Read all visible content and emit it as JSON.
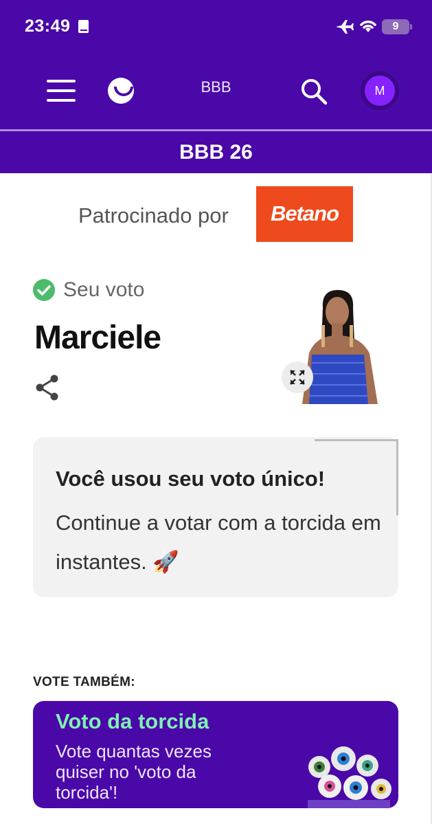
{
  "status_bar": {
    "time": "23:49",
    "battery_level": "9",
    "icons": [
      "book-icon",
      "airplane-icon",
      "wifi-icon",
      "battery-icon"
    ]
  },
  "header": {
    "title": "BBB",
    "avatar_initial": "M",
    "icons": [
      "menu-icon",
      "smile-logo-icon",
      "search-icon"
    ]
  },
  "section": {
    "title": "BBB 26"
  },
  "sponsor": {
    "label": "Patrocinado por",
    "brand": "Betano",
    "brand_color": "#ee4a1e"
  },
  "vote": {
    "status_label": "Seu voto",
    "candidate_name": "Marciele",
    "icons": [
      "check-circle-icon",
      "share-icon",
      "expand-icon"
    ]
  },
  "info_card": {
    "title": "Você usou seu voto único!",
    "text": "Continue a votar com a torcida em instantes. 🚀"
  },
  "also_vote": {
    "label": "VOTE TAMBÉM:",
    "card_title": "Voto da torcida",
    "card_text": "Vote quantas vezes quiser no 'voto da torcida'!"
  },
  "colors": {
    "primary": "#4a08a8",
    "accent_green": "#7ff0b4",
    "check_green": "#4cbb6c",
    "avatar": "#8621ff"
  }
}
